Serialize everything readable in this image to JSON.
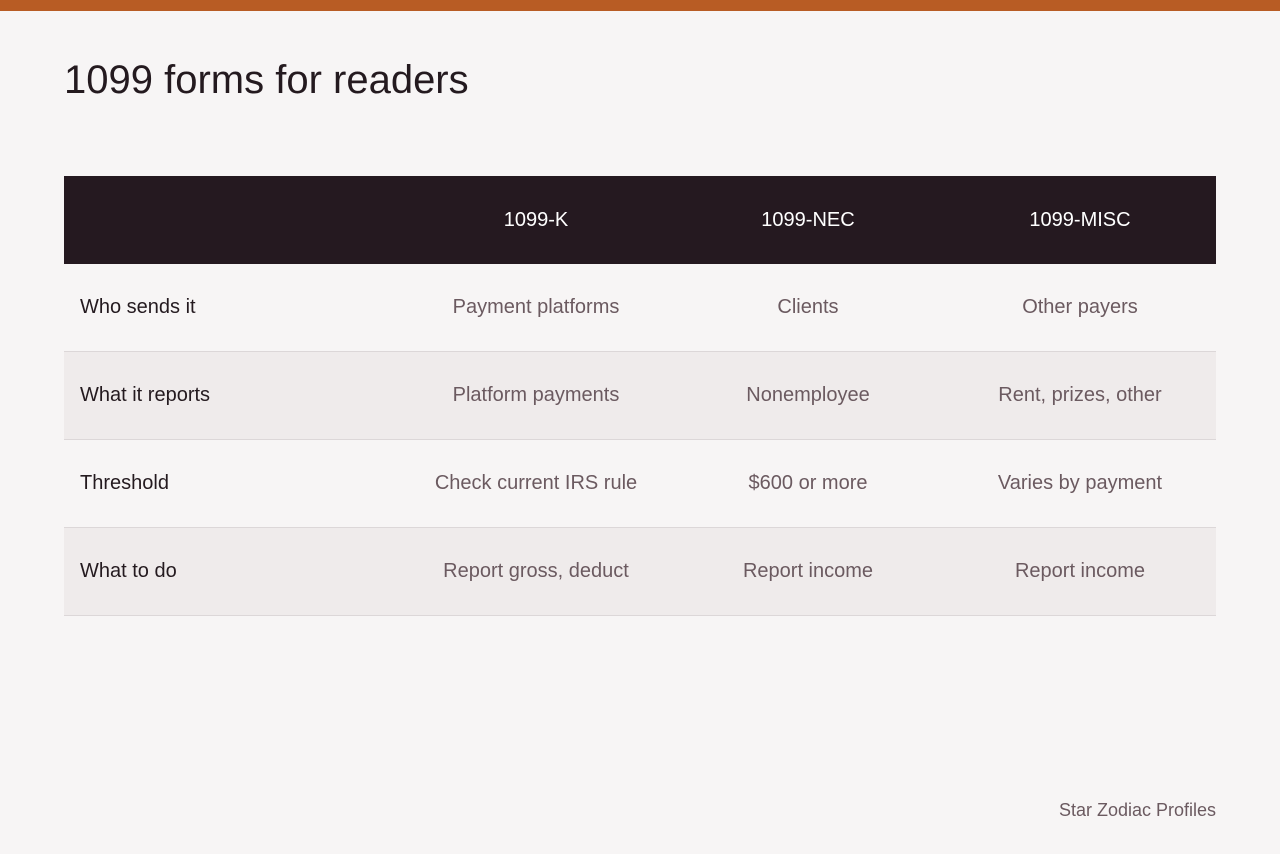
{
  "colors": {
    "accent": "#b85c24",
    "header_bg": "#251920",
    "background": "#f7f5f5",
    "alt_row": "#efebeb"
  },
  "page": {
    "title": "1099 forms for readers"
  },
  "table": {
    "columns": [
      "",
      "1099-K",
      "1099-NEC",
      "1099-MISC"
    ],
    "rows": [
      {
        "label": "Who sends it",
        "values": [
          "Payment platforms",
          "Clients",
          "Other payers"
        ]
      },
      {
        "label": "What it reports",
        "values": [
          "Platform payments",
          "Nonemployee",
          "Rent, prizes, other"
        ]
      },
      {
        "label": "Threshold",
        "values": [
          "Check current IRS rule",
          "$600 or more",
          "Varies by payment"
        ]
      },
      {
        "label": "What to do",
        "values": [
          "Report gross, deduct",
          "Report income",
          "Report income"
        ]
      }
    ]
  },
  "footer": {
    "brand": "Star Zodiac Profiles"
  }
}
